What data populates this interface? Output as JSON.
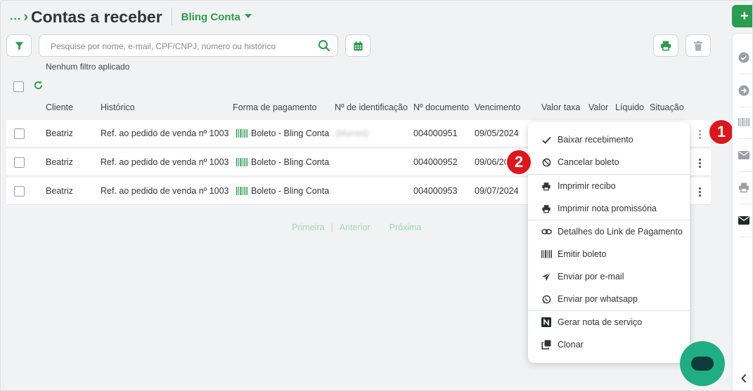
{
  "breadcrumb": {
    "dots": "...",
    "title": "Contas a receber"
  },
  "account": {
    "name": "Bling Conta"
  },
  "search": {
    "placeholder": "Pesquise por nome, e-mail, CPF/CNPJ, número ou histórico"
  },
  "filter_status": "Nenhum filtro aplicado",
  "columns": [
    "Cliente",
    "Histórico",
    "Forma de pagamento",
    "Nº de identificação",
    "Nº documento",
    "Vencimento",
    "Valor taxa",
    "Valor",
    "Líquido",
    "Situação"
  ],
  "rows": [
    {
      "cliente": "Beatriz",
      "historico": "Ref. ao pedido de venda nº 1003",
      "pagamento": "Boleto - Bling Conta",
      "identificacao": "(blurred)",
      "documento": "004000951",
      "vencimento": "09/05/2024"
    },
    {
      "cliente": "Beatriz",
      "historico": "Ref. ao pedido de venda nº 1003",
      "pagamento": "Boleto - Bling Conta",
      "identificacao": "",
      "documento": "004000952",
      "vencimento": "09/06/2024"
    },
    {
      "cliente": "Beatriz",
      "historico": "Ref. ao pedido de venda nº 1003",
      "pagamento": "Boleto - Bling Conta",
      "identificacao": "",
      "documento": "004000953",
      "vencimento": "09/07/2024"
    }
  ],
  "pagination": {
    "first": "Primeira",
    "separator": "|",
    "prev": "Anterior",
    "next": "Próxima"
  },
  "menu": {
    "items": [
      {
        "label": "Baixar recebimento",
        "icon": "check-icon"
      },
      {
        "label": "Cancelar boleto",
        "icon": "ban-icon"
      },
      {
        "label": "Imprimir recibo",
        "icon": "printer-icon"
      },
      {
        "label": "Imprimir nota promissória",
        "icon": "printer-icon"
      },
      {
        "label": "Detalhes do Link de Pagamento",
        "icon": "link-icon"
      },
      {
        "label": "Emitir boleto",
        "icon": "barcode-icon"
      },
      {
        "label": "Enviar por e-mail",
        "icon": "paper-plane-icon"
      },
      {
        "label": "Enviar por whatsapp",
        "icon": "whatsapp-icon"
      },
      {
        "label": "Gerar nota de serviço",
        "icon": "n-logo-icon"
      },
      {
        "label": "Clonar",
        "icon": "clone-icon"
      }
    ]
  },
  "annotations": {
    "badge1": "1",
    "badge2": "2"
  },
  "colors": {
    "brand_green": "#2a9d4e",
    "badge_red": "#e0151b",
    "chat_green": "#1fae83"
  }
}
